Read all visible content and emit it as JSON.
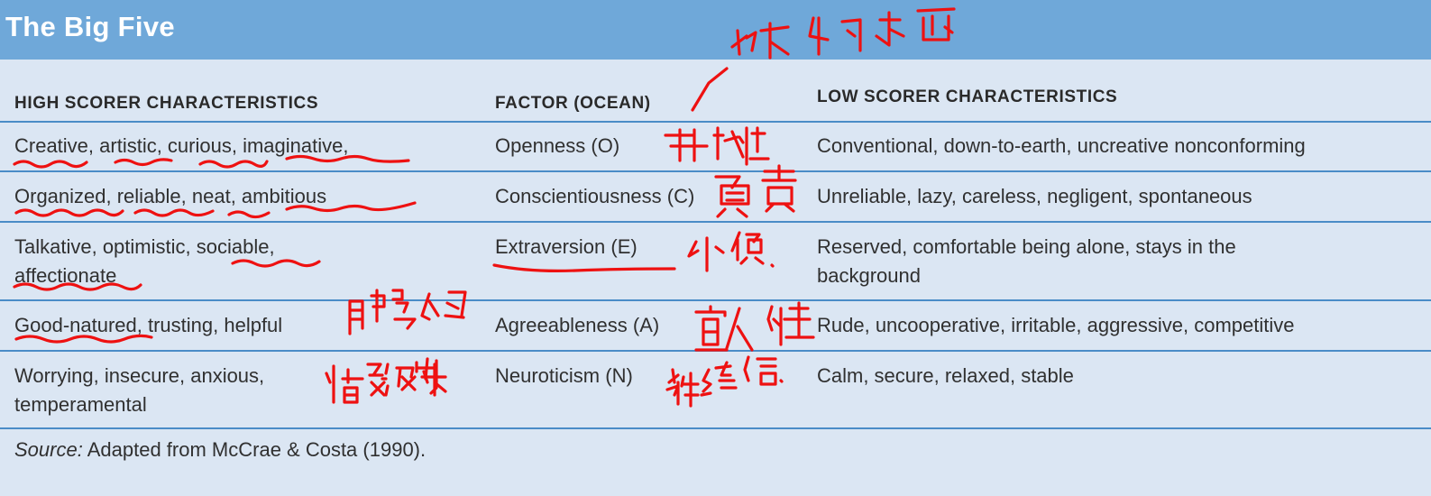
{
  "title": "The Big Five",
  "headers": {
    "high": "HIGH SCORER CHARACTERISTICS",
    "factor": "FACTOR (OCEAN)",
    "low": "LOW SCORER CHARACTERISTICS"
  },
  "rows": [
    {
      "high": "Creative, artistic, curious, imaginative,",
      "factor": "Openness (O)",
      "low": "Conventional, down-to-earth, uncreative nonconforming"
    },
    {
      "high": "Organized, reliable, neat, ambitious",
      "factor": "Conscientiousness (C)",
      "low": "Unreliable, lazy, careless, negligent, spontaneous"
    },
    {
      "high": "Talkative, optimistic, sociable,\naffectionate",
      "factor": "Extraversion (E)",
      "low": "Reserved, comfortable being alone, stays in the\nbackground"
    },
    {
      "high": "Good-natured, trusting, helpful",
      "factor": "Agreeableness (A)",
      "low": "Rude, uncooperative, irritable, aggressive, competitive"
    },
    {
      "high": "Worrying, insecure, anxious,\ntemperamental",
      "factor": "Neuroticism (N)",
      "low": "Calm, secure, relaxed, stable"
    }
  ],
  "source": {
    "label": "Source:",
    "text": " Adapted from McCrae & Costa (1990)."
  },
  "annotation_color": "#ee1111"
}
